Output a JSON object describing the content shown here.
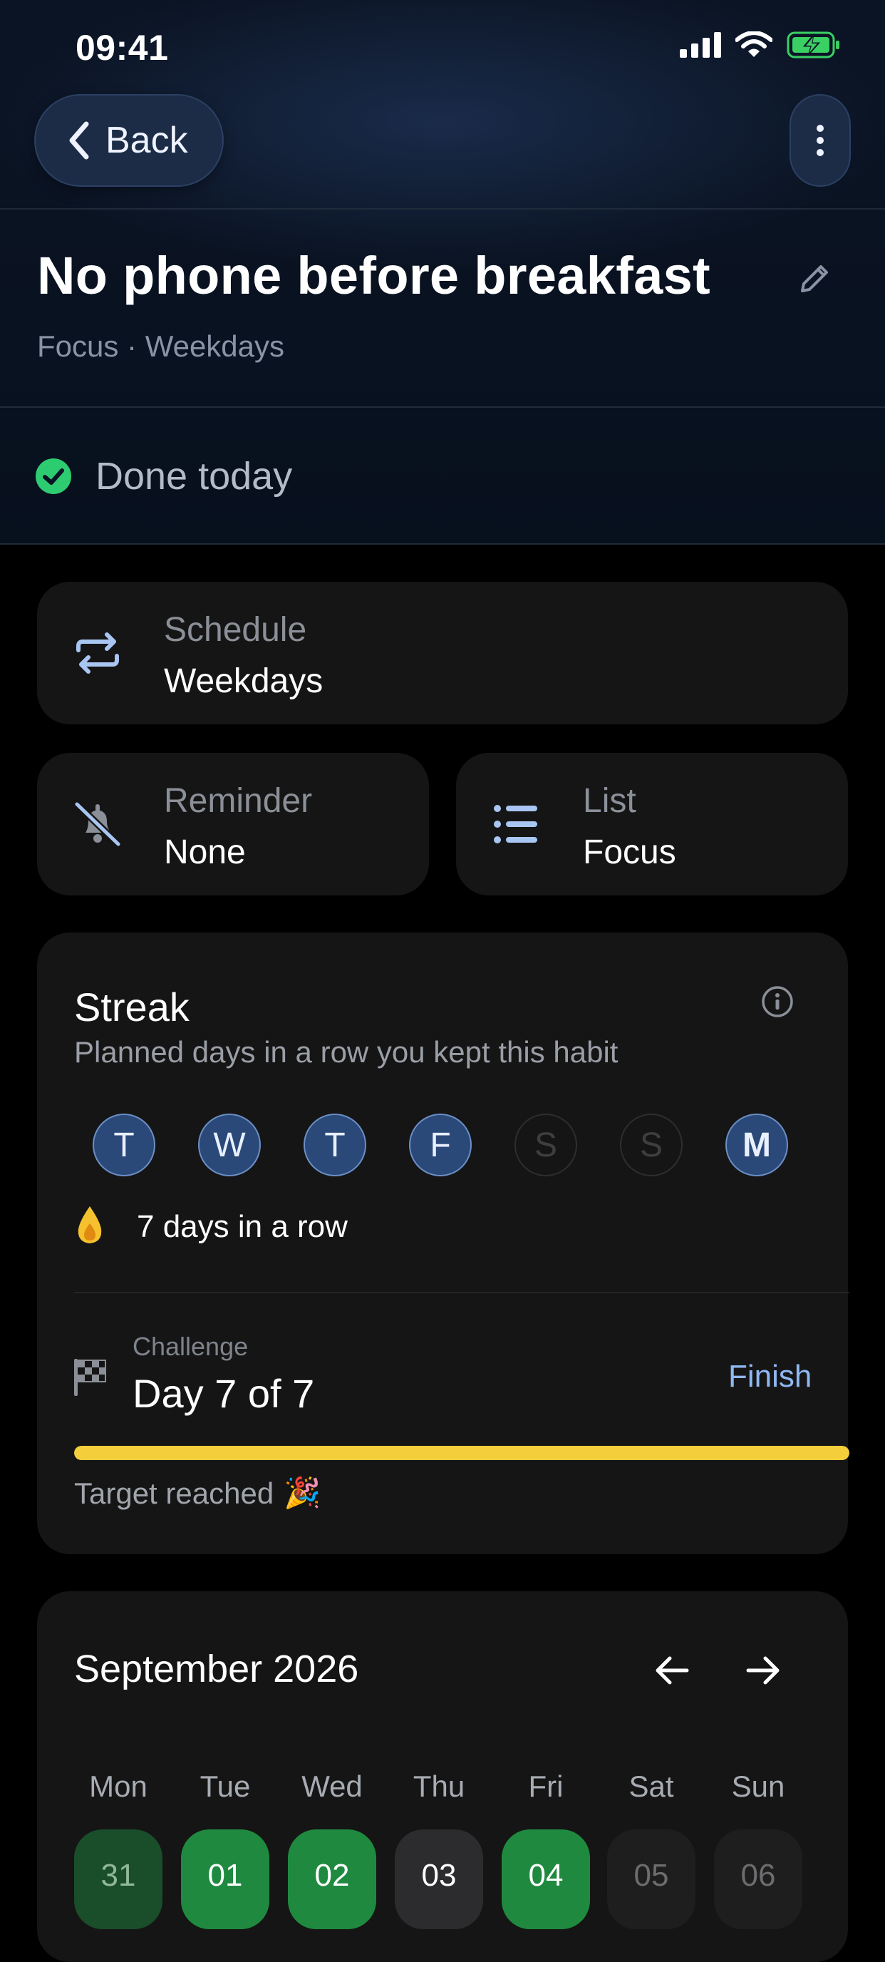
{
  "status_bar": {
    "time": "09:41"
  },
  "nav": {
    "back_label": "Back"
  },
  "habit": {
    "title": "No phone before breakfast",
    "subtitle": "Focus · Weekdays"
  },
  "done": {
    "label": "Done today"
  },
  "schedule": {
    "label": "Schedule",
    "value": "Weekdays"
  },
  "reminder": {
    "label": "Reminder",
    "value": "None"
  },
  "list": {
    "label": "List",
    "value": "Focus"
  },
  "streak": {
    "title": "Streak",
    "subtitle": "Planned days in a row you kept this habit",
    "days": [
      {
        "letter": "T",
        "kept": true
      },
      {
        "letter": "W",
        "kept": true
      },
      {
        "letter": "T",
        "kept": true
      },
      {
        "letter": "F",
        "kept": true
      },
      {
        "letter": "S",
        "kept": false
      },
      {
        "letter": "S",
        "kept": false
      },
      {
        "letter": "M",
        "kept": true
      }
    ],
    "row_text": "7 days in a row"
  },
  "challenge": {
    "label": "Challenge",
    "value": "Day 7 of 7",
    "action": "Finish",
    "progress": 1.0,
    "note": "Target reached",
    "note_emoji": "🎉"
  },
  "calendar": {
    "month": "September 2026",
    "weekdays": [
      "Mon",
      "Tue",
      "Wed",
      "Thu",
      "Fri",
      "Sat",
      "Sun"
    ],
    "dates": [
      "31",
      "01",
      "02",
      "03",
      "04",
      "05",
      "06"
    ],
    "date_states": [
      "kept-prev-month",
      "kept",
      "kept",
      "today",
      "kept",
      "not-planned",
      "not-planned"
    ]
  },
  "colors": {
    "accent": "#2a4978",
    "kept_green": "#1f8a3f",
    "progress_yellow": "#f5cf3b",
    "done_check": "#2ecc71",
    "link_blue": "#8fb8f2"
  },
  "icons": {
    "back": "chevron-left-icon",
    "more": "more-vertical-icon",
    "edit": "pencil-icon",
    "done": "check-circle-icon",
    "schedule": "repeat-icon",
    "reminder": "bell-off-icon",
    "list": "list-icon",
    "info": "info-icon",
    "streak": "flame-icon",
    "challenge": "flag-icon",
    "prev": "arrow-left-icon",
    "next": "arrow-right-icon"
  }
}
